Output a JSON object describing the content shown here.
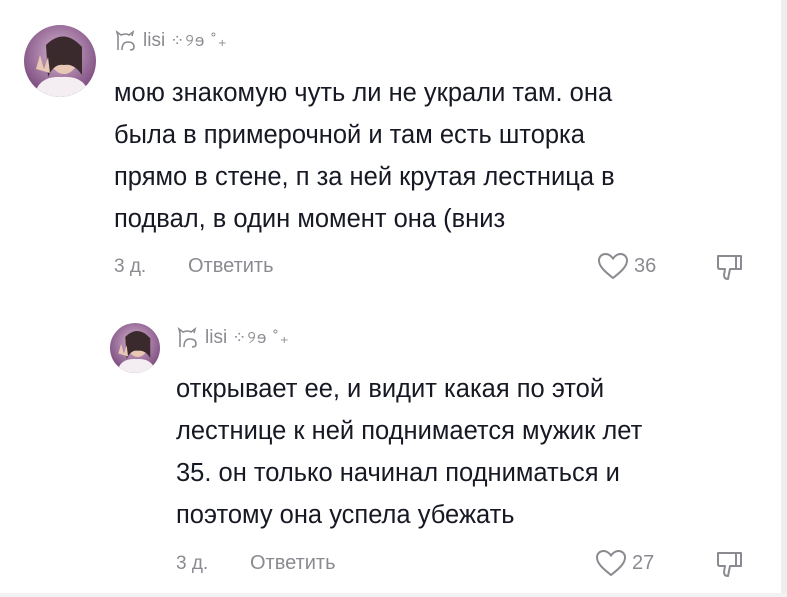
{
  "comments": [
    {
      "username": "lisi",
      "username_deco": "⁘୨ɘ ˚₊",
      "text_lines": [
        "мою знакомую чуть ли не украли там. она",
        "была в примерочной и там есть шторка",
        "прямо в стене, п за ней крутая лестница в",
        "подвал, в один момент она (вниз"
      ],
      "time": "3 д.",
      "reply_label": "Ответить",
      "likes": "36"
    },
    {
      "username": "lisi",
      "username_deco": "⁘୨ɘ ˚₊",
      "text_lines": [
        "открывает ее, и видит какая по этой",
        "лестнице к ней поднимается мужик лет",
        "35. он только начинал подниматься и",
        "поэтому она успела убежать"
      ],
      "time": "3 д.",
      "reply_label": "Ответить",
      "likes": "27"
    }
  ],
  "icons": {
    "user_badge": "cat-outline-icon",
    "like": "heart-outline-icon",
    "dislike": "thumbs-down-outline-icon"
  },
  "colors": {
    "text": "#161823",
    "muted": "#8a8b91",
    "background": "#ffffff"
  }
}
